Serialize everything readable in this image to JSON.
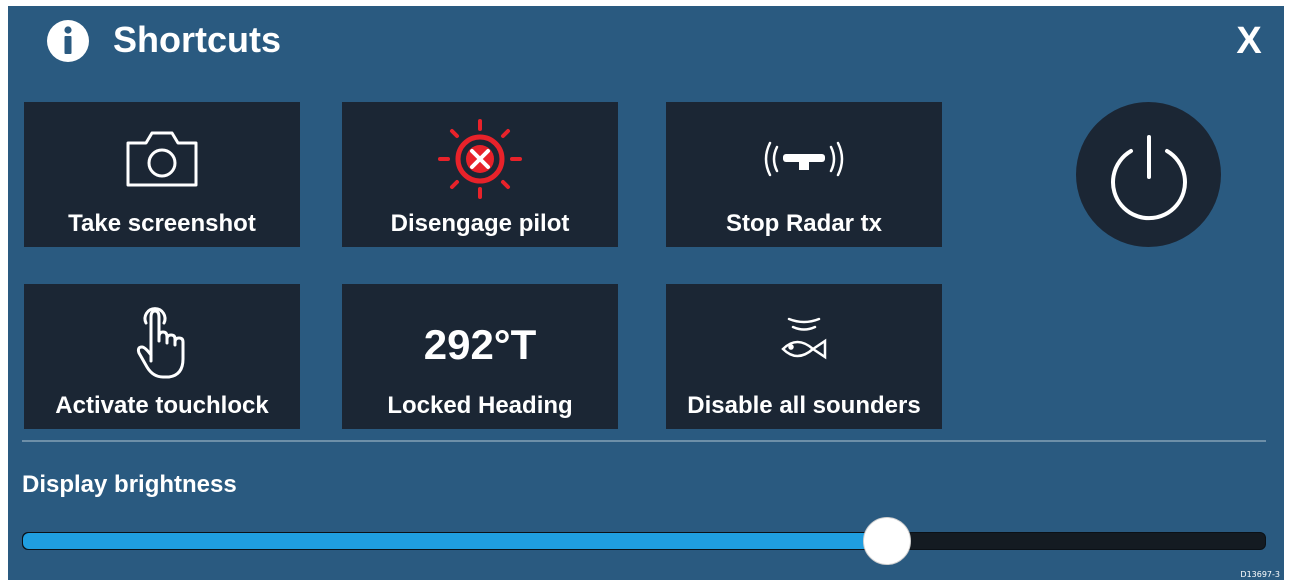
{
  "header": {
    "title": "Shortcuts",
    "close_label": "X",
    "info_icon": "info-icon"
  },
  "tiles": [
    {
      "label": "Take screenshot",
      "icon": "camera-icon"
    },
    {
      "label": "Disengage pilot",
      "icon": "disengage-pilot-icon"
    },
    {
      "label": "Stop Radar tx",
      "icon": "radar-icon"
    },
    {
      "label": "Activate touchlock",
      "icon": "touch-hand-icon"
    },
    {
      "label": "Locked Heading",
      "value": "292°T"
    },
    {
      "label": "Disable all sounders",
      "icon": "fish-sonar-icon"
    }
  ],
  "power": {
    "icon": "power-icon"
  },
  "brightness": {
    "label": "Display brightness",
    "level": 0.695
  },
  "colors": {
    "panel": "#2a5a80",
    "tile": "#1b2634",
    "slider_fill": "#1f9ee0",
    "pilot_red": "#e8222a"
  },
  "footer": {
    "ref_code": "D13697-3"
  }
}
